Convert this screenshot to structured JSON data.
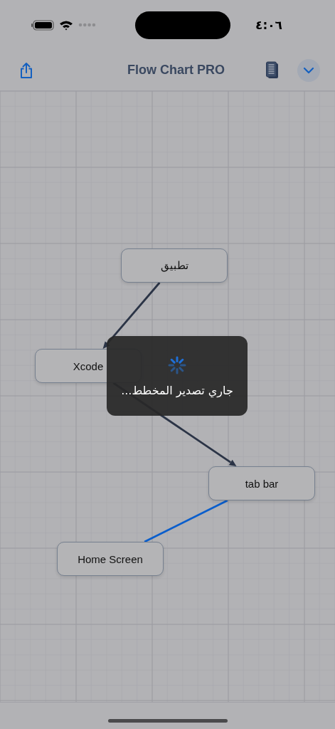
{
  "status_bar": {
    "time": "٤:٠٦"
  },
  "nav_bar": {
    "title": "Flow Chart PRO"
  },
  "canvas": {
    "nodes": [
      {
        "label": "تطبيق"
      },
      {
        "label": "Xcode"
      },
      {
        "label": "tab bar"
      },
      {
        "label": "Home Screen"
      }
    ],
    "edges": [
      {
        "color": "#2b3446",
        "arrow": true
      },
      {
        "color": "#2b3446",
        "arrow": true
      },
      {
        "color": "#0a5ecc",
        "arrow": false
      }
    ]
  },
  "progress_overlay": {
    "message": "جاري تصدير المخطط..."
  }
}
